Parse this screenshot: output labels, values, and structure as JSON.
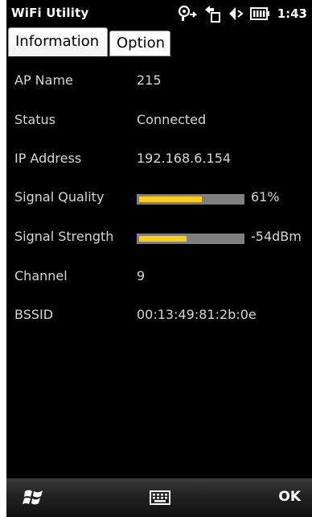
{
  "window": {
    "title": "WiFi Utility",
    "clock": "1:43"
  },
  "status_icons": [
    "signal-icon",
    "data-connection-icon",
    "volume-icon",
    "battery-icon"
  ],
  "tabs": [
    {
      "label": "Information",
      "active": true
    },
    {
      "label": "Option",
      "active": false
    }
  ],
  "info": {
    "ap_name": {
      "label": "AP Name",
      "value": "215"
    },
    "status": {
      "label": "Status",
      "value": "Connected"
    },
    "ip_address": {
      "label": "IP Address",
      "value": "192.168.6.154"
    },
    "signal_quality": {
      "label": "Signal Quality",
      "value": "61%",
      "level": 0.61
    },
    "signal_strength": {
      "label": "Signal Strength",
      "value": "-54dBm",
      "level": 0.46
    },
    "channel": {
      "label": "Channel",
      "value": "9"
    },
    "bssid": {
      "label": "BSSID",
      "value": "00:13:49:81:2b:0e"
    }
  },
  "softkeys": {
    "start_icon": "windows-start-icon",
    "keyboard_icon": "keyboard-icon",
    "right_label": "OK"
  },
  "colors": {
    "background": "#000000",
    "text": "#d6d6d6",
    "bar_track": "#7f7f7f",
    "bar_fill": "#ffcc1a"
  }
}
